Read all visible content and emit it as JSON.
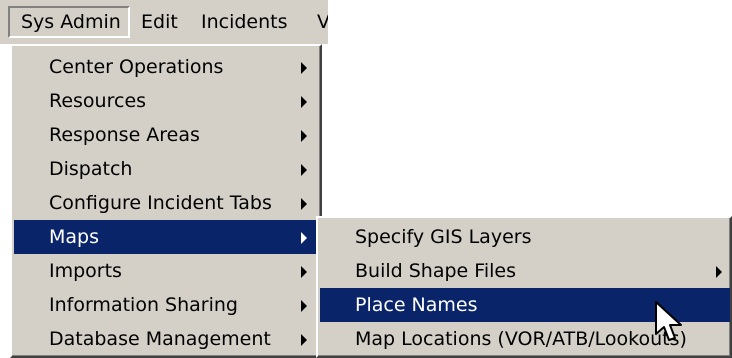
{
  "menubar": {
    "items": [
      "Sys Admin",
      "Edit",
      "Incidents",
      "V"
    ]
  },
  "sys_admin_menu": {
    "items": [
      {
        "label": "Center Operations",
        "has_submenu": true
      },
      {
        "label": "Resources",
        "has_submenu": true
      },
      {
        "label": "Response Areas",
        "has_submenu": true
      },
      {
        "label": "Dispatch",
        "has_submenu": true
      },
      {
        "label": "Configure Incident Tabs",
        "has_submenu": true
      },
      {
        "label": "Maps",
        "has_submenu": true,
        "highlighted": true
      },
      {
        "label": "Imports",
        "has_submenu": true
      },
      {
        "label": "Information Sharing",
        "has_submenu": true
      },
      {
        "label": "Database Management",
        "has_submenu": true
      }
    ]
  },
  "maps_submenu": {
    "items": [
      {
        "label": "Specify GIS Layers",
        "has_submenu": false
      },
      {
        "label": "Build Shape Files",
        "has_submenu": true
      },
      {
        "label": "Place Names",
        "has_submenu": false,
        "highlighted": true
      },
      {
        "label": "Map Locations (VOR/ATB/Lookouts)",
        "has_submenu": false
      }
    ]
  },
  "colors": {
    "menu_background": "#d4d0c8",
    "highlight": "#0a246a",
    "highlight_text": "#ffffff"
  },
  "cursor": "arrow-pointer-icon"
}
